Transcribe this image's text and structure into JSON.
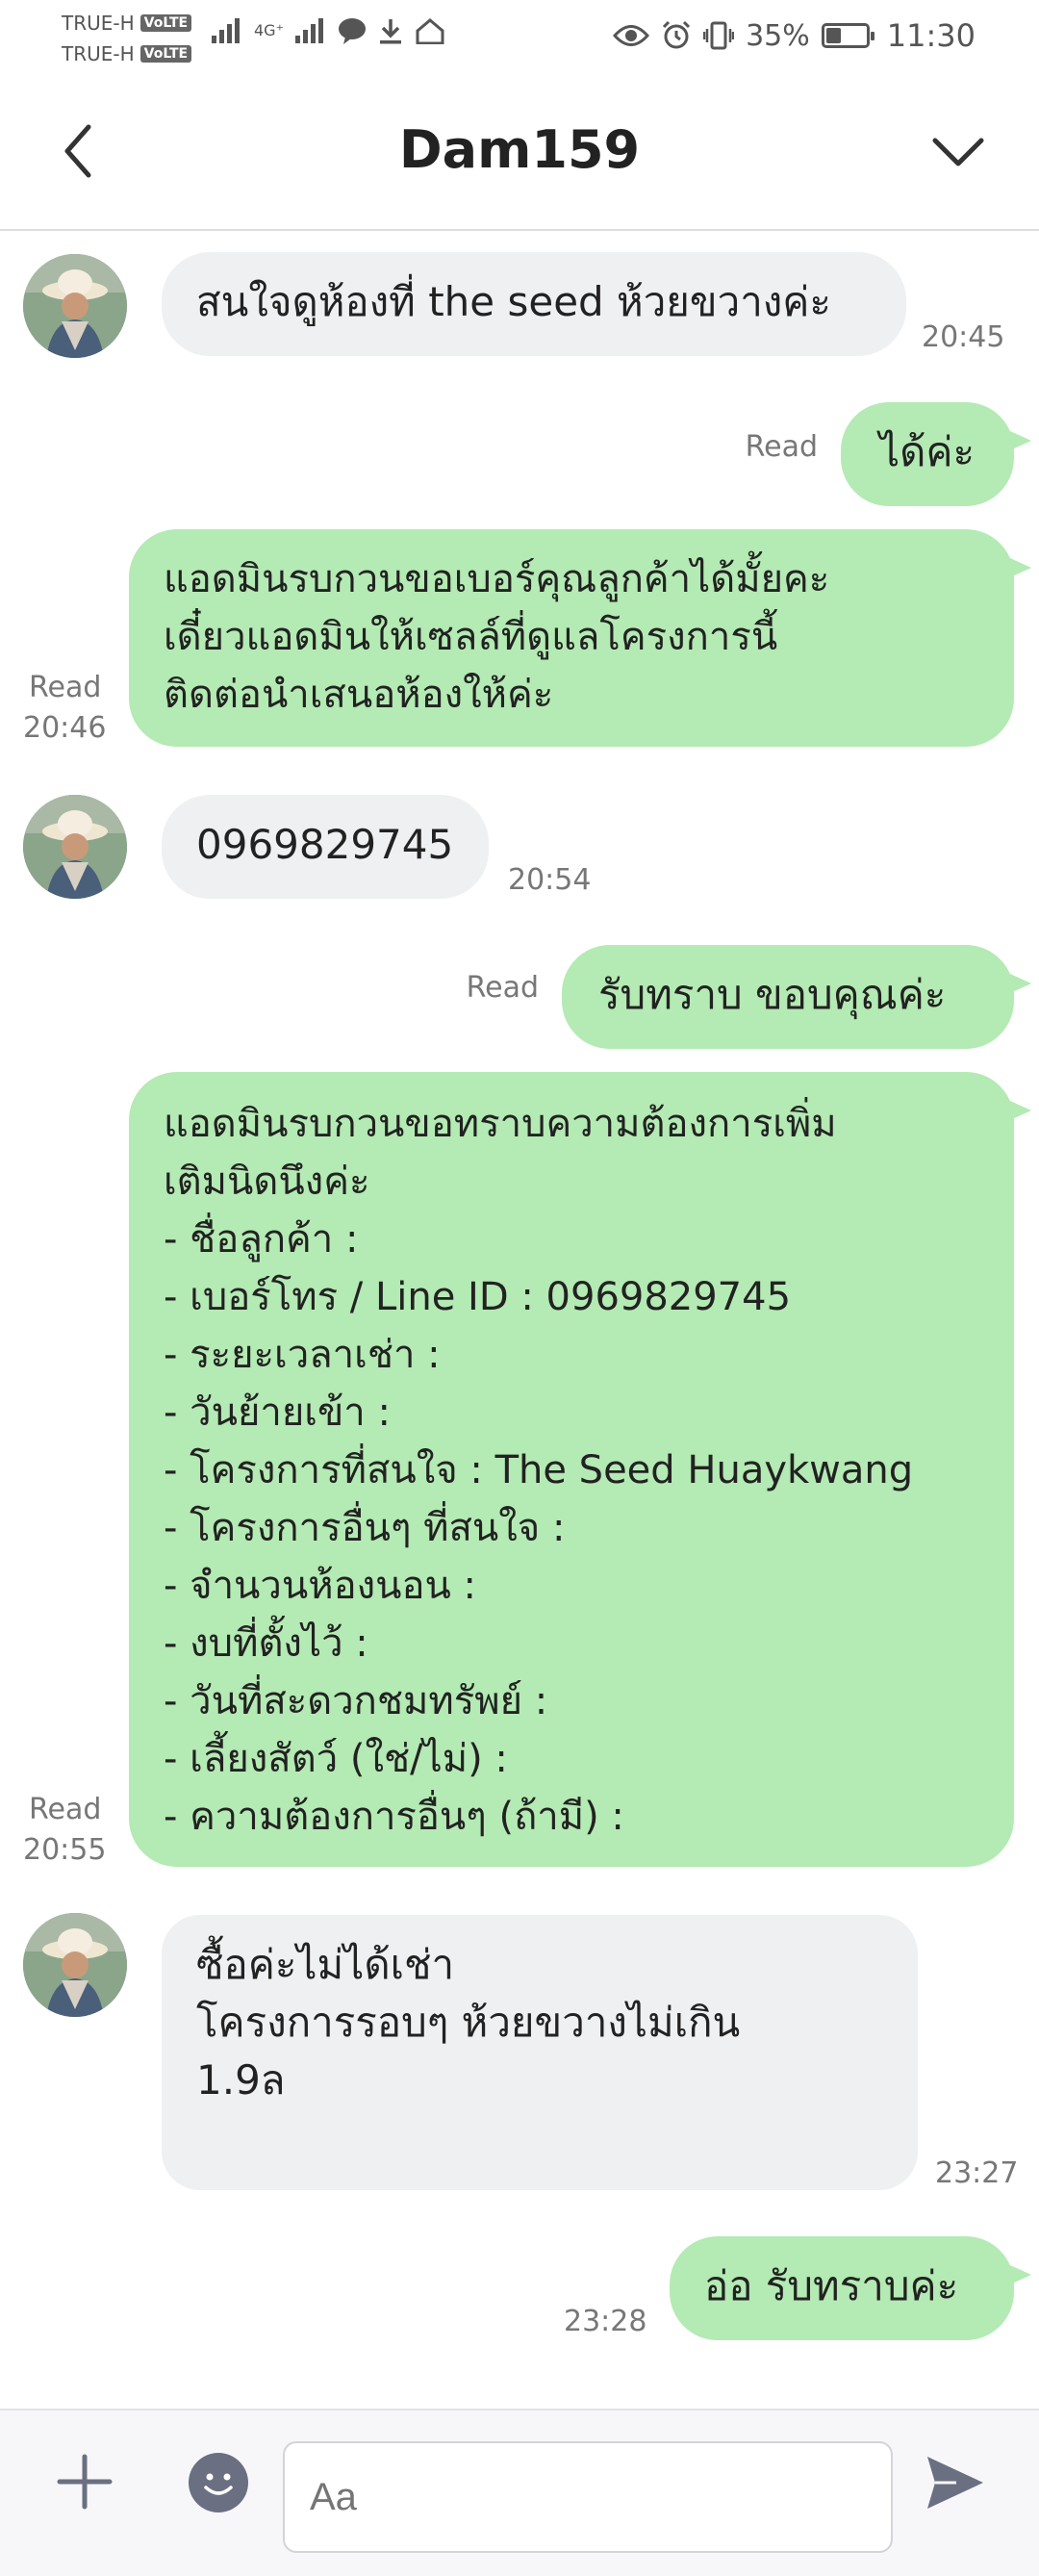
{
  "status_bar": {
    "carrier1": "TRUE-H",
    "carrier2": "TRUE-H",
    "volte": "VoLTE",
    "network": "4G⁺",
    "battery_text": "35%",
    "battery_level": 0.35,
    "time": "11:30"
  },
  "header": {
    "title": "Dam159"
  },
  "messages": [
    {
      "text": "สนใจดูห้องที่ the seed ห้วยขวางค่ะ",
      "time": "20:45"
    },
    {
      "text": "ได้ค่ะ",
      "read": "Read"
    },
    {
      "text": "แอดมินรบกวนขอเบอร์คุณลูกค้าได้มั้ยคะ\nเดี๋ยวแอดมินให้เซลล์ที่ดูแลโครงการนี้\nติดต่อนำเสนอห้องให้ค่ะ",
      "read": "Read",
      "time": "20:46"
    },
    {
      "text": "0969829745",
      "time": "20:54"
    },
    {
      "text": "รับทราบ ขอบคุณค่ะ",
      "read": "Read"
    },
    {
      "text": "แอดมินรบกวนขอทราบความต้องการเพิ่ม\nเติมนิดนึงค่ะ\n- ชื่อลูกค้า :\n- เบอร์โทร / Line ID : 0969829745\n- ระยะเวลาเช่า :\n- วันย้ายเข้า :\n- โครงการที่สนใจ : The Seed Huaykwang\n- โครงการอื่นๆ ที่สนใจ :\n- จำนวนห้องนอน :\n- งบที่ตั้งไว้ :\n- วันที่สะดวกชมทรัพย์ :\n- เลี้ยงสัตว์ (ใช่/ไม่) :\n- ความต้องการอื่นๆ (ถ้ามี) :",
      "read": "Read",
      "time": "20:55"
    },
    {
      "text": "ซื้อค่ะไม่ได้เช่า\nโครงการรอบๆ ห้วยขวางไม่เกิน\n1.9ล",
      "time": "23:27"
    },
    {
      "text": "อ่อ รับทราบค่ะ",
      "time": "23:28"
    }
  ],
  "input": {
    "placeholder": "Aa"
  },
  "icons": {
    "back": "chevron-left-icon",
    "menu": "chevron-down-icon",
    "plus": "plus-icon",
    "emoji": "emoji-icon",
    "send": "send-icon"
  },
  "colors": {
    "outgoing_bubble": "#b4eab3",
    "incoming_bubble": "#eff0f2",
    "icon": "#6a6f82"
  }
}
